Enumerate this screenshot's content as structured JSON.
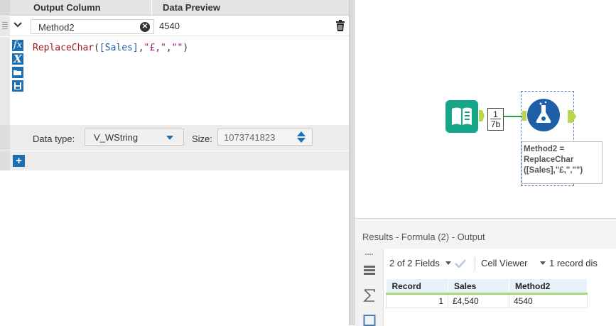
{
  "formula_panel": {
    "header": {
      "output_column": "Output Column",
      "data_preview": "Data Preview"
    },
    "row": {
      "output_name": "Method2",
      "preview_value": "4540"
    },
    "expression": {
      "fn": "ReplaceChar",
      "open": "(",
      "field": "[Sales]",
      "comma1": ",",
      "arg2": "\"£,\"",
      "comma2": ",",
      "arg3": "\"\"",
      "close": ")"
    },
    "data_type_label": "Data type:",
    "data_type_value": "V_WString",
    "size_label": "Size:",
    "size_value": "1073741823",
    "tool_icons": [
      "fx-icon",
      "variable-icon",
      "open-folder-icon",
      "save-icon"
    ]
  },
  "canvas": {
    "record_badge": {
      "count": "1",
      "size": "7b"
    },
    "annotation": [
      "Method2 =",
      "ReplaceChar",
      "([Sales],\"£,\",\"\")"
    ]
  },
  "results": {
    "title": "Results - Formula (2) - Output",
    "fields_label": "2 of 2 Fields",
    "cell_viewer_label": "Cell Viewer",
    "records_label": "1 record dis",
    "table": {
      "headers": [
        "Record",
        "Sales",
        "Method2"
      ],
      "rows": [
        [
          "1",
          "£4,540",
          "4540"
        ]
      ]
    }
  },
  "colors": {
    "accent": "#1c6fb3",
    "connector": "#b9d64d",
    "input_tool": "#17a589",
    "formula_tool": "#1f5fa8",
    "wire": "#2f9e44"
  }
}
